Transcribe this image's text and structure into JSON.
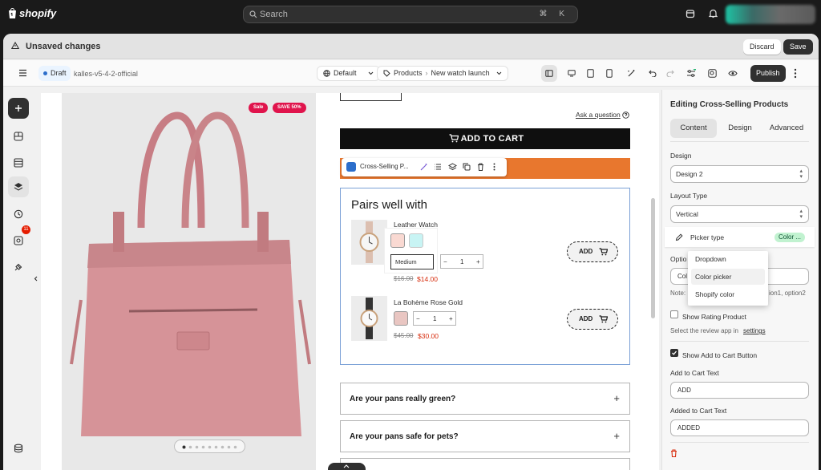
{
  "topbar": {
    "logo_text": "shopify",
    "search_placeholder": "Search",
    "search_shortcut": "⌘ K"
  },
  "save_bar": {
    "title": "Unsaved changes",
    "discard_label": "Discard",
    "save_label": "Save"
  },
  "toolbar": {
    "status_badge": "Draft",
    "theme_name": "kalles-v5-4-2-official",
    "template_selector": "Default",
    "page_type": "Products",
    "page_name": "New watch launch",
    "publish_label": "Publish"
  },
  "sidebar": {
    "apps_badge": "11"
  },
  "canvas": {
    "tag_sale": "Sale",
    "tag_save": "SAVE 50%",
    "ask_question": "Ask a question",
    "add_to_cart": "ADD TO CART",
    "section_toolbar_name": "Cross-Selling P...",
    "pairs_title": "Pairs well with",
    "products": [
      {
        "name": "Leather Watch",
        "size": "Medium",
        "qty": "1",
        "old_price": "$16.00",
        "price": "$14.00",
        "add_label": "ADD",
        "swatches": [
          "#f9d9d2",
          "#c8f4f4"
        ]
      },
      {
        "name": "La Bohème Rose Gold",
        "qty": "1",
        "old_price": "$45.00",
        "price": "$30.00",
        "add_label": "ADD",
        "swatches": [
          "#e9c6c2"
        ]
      }
    ],
    "faq": [
      "Are your pans really green?",
      "Are your pans safe for pets?"
    ]
  },
  "panel": {
    "title": "Editing Cross-Selling Products",
    "tabs": [
      "Content",
      "Design",
      "Advanced"
    ],
    "active_tab": "Content",
    "design_label": "Design",
    "design_value": "Design 2",
    "layout_label": "Layout Type",
    "layout_value": "Vertical",
    "picker_label": "Picker type",
    "picker_value": "Color ...",
    "options_label": "Optio",
    "options_value": "Col",
    "note_label": "Note:",
    "note_tail": "ion1, option2",
    "show_rating_label": "Show Rating Product",
    "review_hint": "Select the review app in",
    "review_link": "settings",
    "show_add_label": "Show Add to Cart Button",
    "add_text_label": "Add to Cart Text",
    "add_text_value": "ADD",
    "added_text_label": "Added to Cart Text",
    "added_text_value": "ADDED"
  },
  "picker_dropdown": {
    "options": [
      "Dropdown",
      "Color picker",
      "Shopify color"
    ],
    "selected": "Color picker"
  },
  "colors": {
    "accent_dark": "#303030",
    "sale_tag": "#e0144c",
    "orange_button": "#e8772e",
    "price_red": "#d72c0d",
    "success_pill": "#c1f2d0"
  }
}
